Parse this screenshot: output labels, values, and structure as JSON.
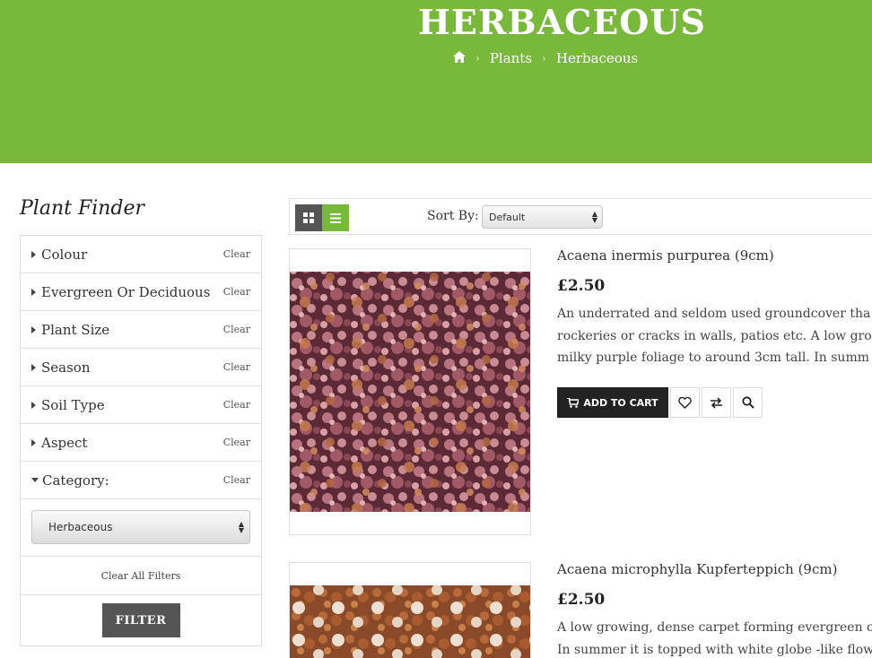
{
  "header": {
    "title": "HERBACEOUS",
    "breadcrumb": {
      "home_icon": "home-icon",
      "items": [
        "Plants",
        "Herbaceous"
      ]
    }
  },
  "sidebar": {
    "title": "Plant Finder",
    "filters": [
      {
        "label": "Colour",
        "clear": "Clear"
      },
      {
        "label": "Evergreen Or Deciduous",
        "clear": "Clear"
      },
      {
        "label": "Plant Size",
        "clear": "Clear"
      },
      {
        "label": "Season",
        "clear": "Clear"
      },
      {
        "label": "Soil Type",
        "clear": "Clear"
      },
      {
        "label": "Aspect",
        "clear": "Clear"
      },
      {
        "label": "Category:",
        "clear": "Clear"
      }
    ],
    "category_select": "Herbaceous",
    "clear_all": "Clear All Filters",
    "filter_button": "FILTER"
  },
  "toolbar": {
    "view_modes": [
      "grid",
      "list"
    ],
    "active_view": "list",
    "sort_label": "Sort By:",
    "sort_value": "Default"
  },
  "products": [
    {
      "name": "Acaena inermis purpurea (9cm)",
      "price": "£2.50",
      "desc_lines": [
        "An underrated and seldom used groundcover tha",
        "rockeries or cracks in walls, patios etc. A low grow",
        "milky purple foliage to around 3cm tall. In summ"
      ],
      "add_to_cart": "ADD TO CART"
    },
    {
      "name": "Acaena microphylla Kupferteppich (9cm)",
      "price": "£2.50",
      "desc_lines": [
        "A low growing, dense carpet forming evergreen c",
        "In summer it is topped with white globe -like flow"
      ]
    }
  ],
  "colors": {
    "brand_green": "#78b83a",
    "dark": "#222222",
    "grey_button": "#555555"
  }
}
